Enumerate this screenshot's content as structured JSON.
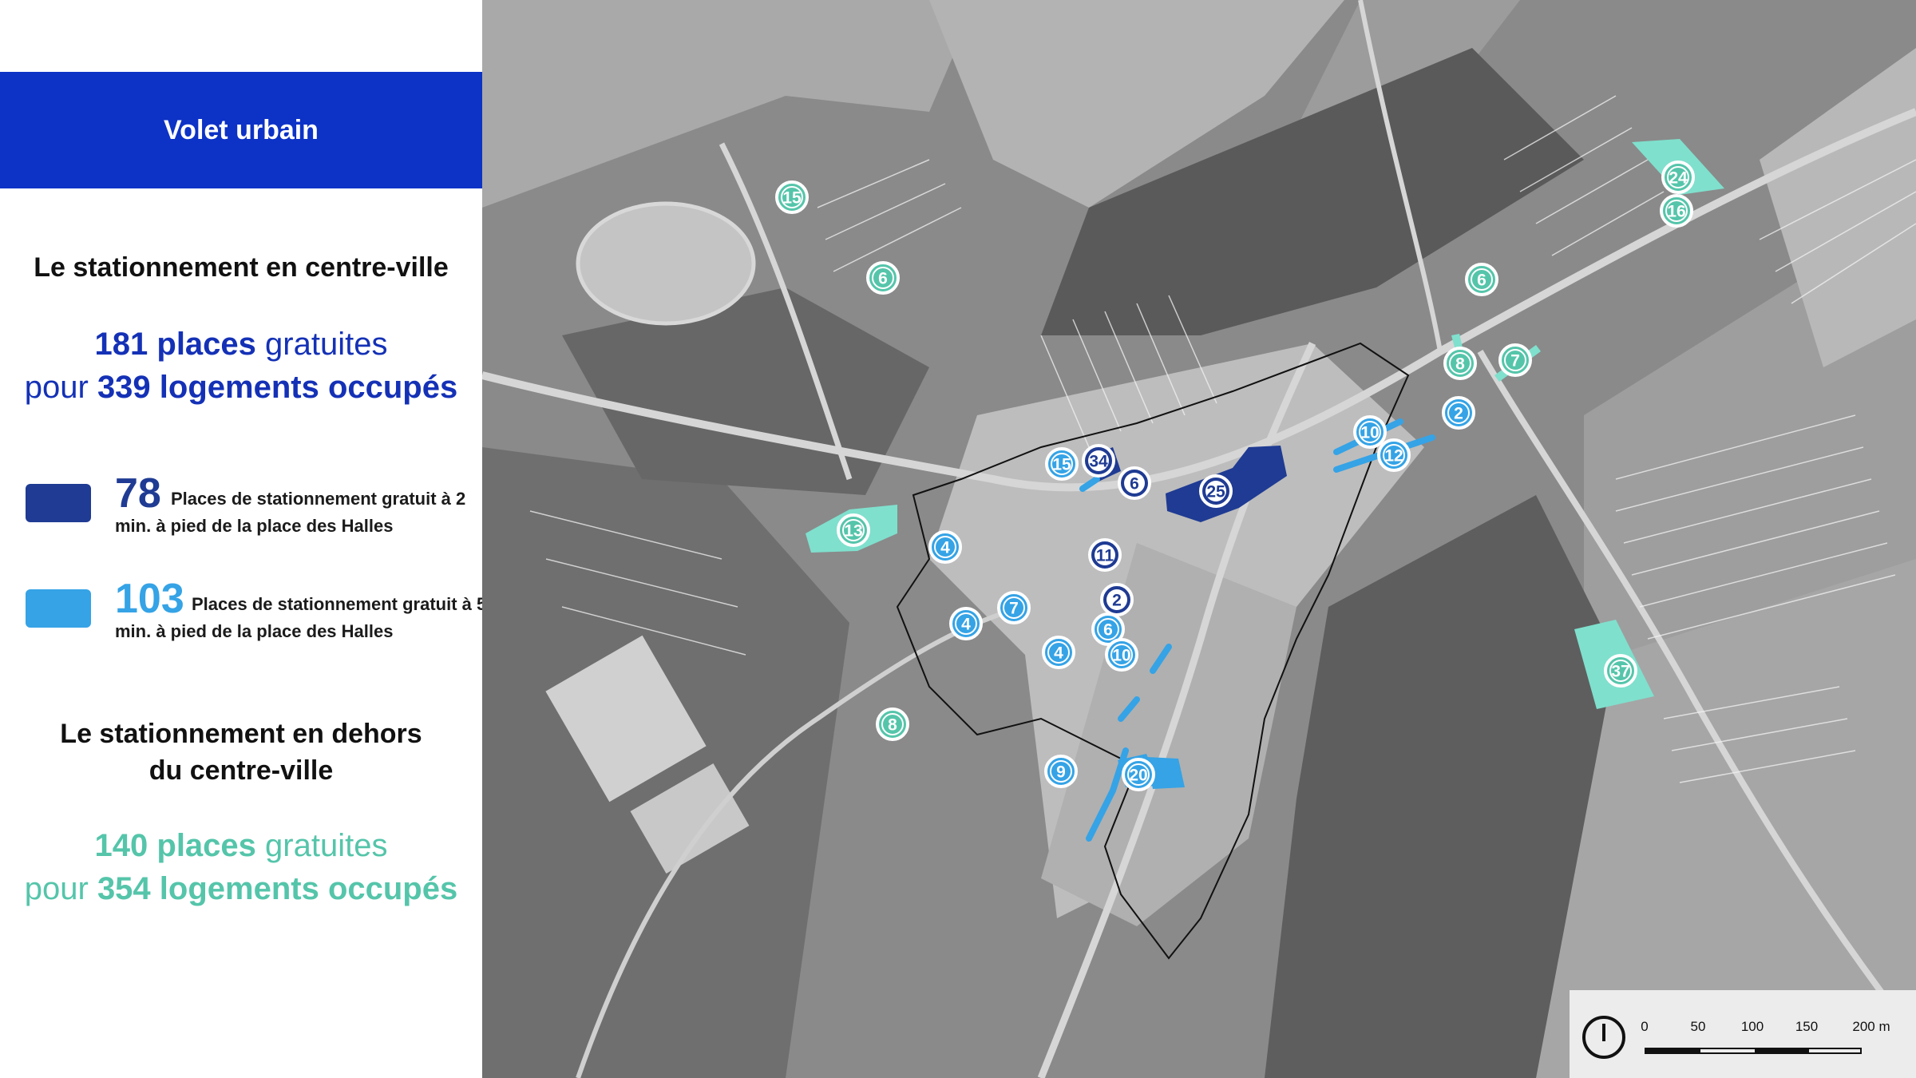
{
  "panel": {
    "banner_title": "Volet urbain",
    "centre_heading": "Le stationnement en centre-ville",
    "centre_stats": {
      "places_num": "181 places",
      "places_rest": " gratuites",
      "prefix": "pour ",
      "logements_num": "339 logements occupés"
    },
    "legend": [
      {
        "number": "78",
        "text": "Places de stationnement gratuit à 2 min. à pied de la place des Halles",
        "color": "#1f3b93"
      },
      {
        "number": "103",
        "text": "Places de stationnement gratuit à 5 min. à pied de la place des Halles",
        "color": "#35a3e6"
      }
    ],
    "outside_heading_l1": "Le stationnement en dehors",
    "outside_heading_l2": "du centre-ville",
    "outside_stats": {
      "places_num": "140 places",
      "places_rest": " gratuites",
      "prefix": "pour ",
      "logements_num": "354 logements occupés"
    }
  },
  "colors": {
    "banner": "#0c32c6",
    "dark_blue": "#1f3b93",
    "light_blue": "#35a3e6",
    "teal": "#55c5aa",
    "teal_fill": "#7fe0cd"
  },
  "map": {
    "markers": [
      {
        "label": "15",
        "kind": "teal"
      },
      {
        "label": "6",
        "kind": "teal"
      },
      {
        "label": "24",
        "kind": "teal"
      },
      {
        "label": "16",
        "kind": "teal"
      },
      {
        "label": "6",
        "kind": "teal"
      },
      {
        "label": "8",
        "kind": "teal"
      },
      {
        "label": "7",
        "kind": "teal"
      },
      {
        "label": "13",
        "kind": "teal"
      },
      {
        "label": "8",
        "kind": "teal"
      },
      {
        "label": "37",
        "kind": "teal"
      },
      {
        "label": "34",
        "kind": "dark"
      },
      {
        "label": "6",
        "kind": "dark"
      },
      {
        "label": "25",
        "kind": "dark"
      },
      {
        "label": "11",
        "kind": "dark"
      },
      {
        "label": "2",
        "kind": "dark"
      },
      {
        "label": "15",
        "kind": "light"
      },
      {
        "label": "10",
        "kind": "light"
      },
      {
        "label": "12",
        "kind": "light"
      },
      {
        "label": "2",
        "kind": "light"
      },
      {
        "label": "4",
        "kind": "light"
      },
      {
        "label": "7",
        "kind": "light"
      },
      {
        "label": "4",
        "kind": "light"
      },
      {
        "label": "4",
        "kind": "light"
      },
      {
        "label": "6",
        "kind": "light"
      },
      {
        "label": "10",
        "kind": "light"
      },
      {
        "label": "9",
        "kind": "light"
      },
      {
        "label": "20",
        "kind": "light"
      }
    ],
    "scale": {
      "labels": [
        "0",
        "50",
        "100",
        "150",
        "200 m"
      ],
      "north_icon": "north-arrow-icon"
    },
    "logo_icon": "leaf-logo-icon"
  }
}
